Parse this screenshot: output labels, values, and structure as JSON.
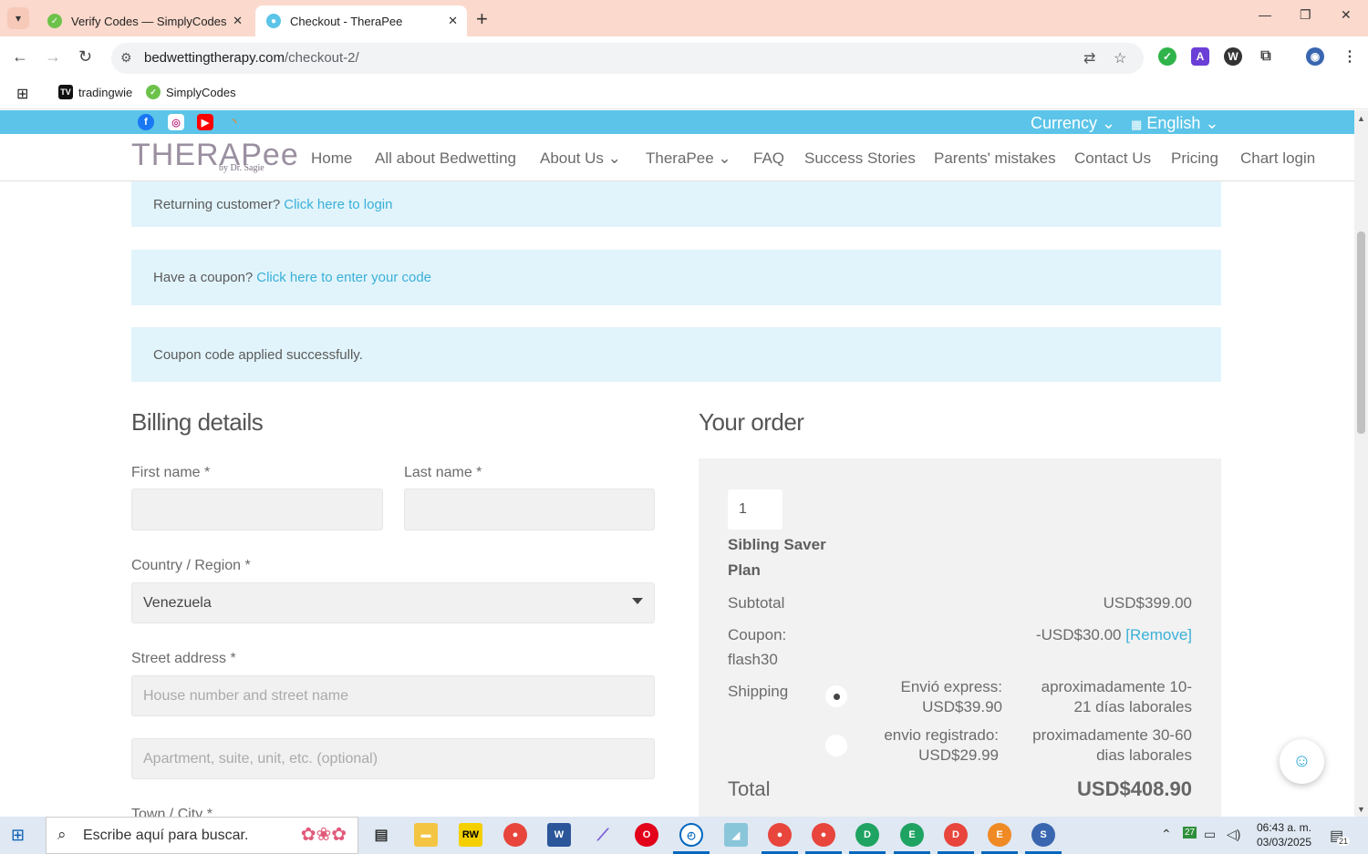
{
  "browser": {
    "tabs": [
      {
        "title": "Verify Codes — SimplyCodes",
        "active": false
      },
      {
        "title": "Checkout - TheraPee",
        "active": true
      }
    ],
    "url_host": "bedwettingtherapy.com",
    "url_path": "/checkout-2/",
    "bookmarks": [
      "tradingwie",
      "SimplyCodes"
    ]
  },
  "site": {
    "strip": {
      "currency": "Currency",
      "language": "English"
    },
    "logo": {
      "main": "THERAPee",
      "sub": "by Dr. Sagie"
    },
    "menu": [
      "Home",
      "All about Bedwetting",
      "About Us",
      "TheraPee",
      "FAQ",
      "Success Stories",
      "Parents' mistakes",
      "Contact Us",
      "Pricing",
      "Chart login"
    ]
  },
  "notices": {
    "returning_text": "Returning customer?",
    "returning_link": "Click here to login",
    "coupon_text": "Have a coupon?",
    "coupon_link": "Click here to enter your code",
    "coupon_applied": "Coupon code applied successfully."
  },
  "billing": {
    "title": "Billing details",
    "first_name_label": "First name *",
    "last_name_label": "Last name *",
    "country_label": "Country / Region *",
    "country_value": "Venezuela",
    "street_label": "Street address *",
    "street_placeholder": "House number and street name",
    "apt_placeholder": "Apartment, suite, unit, etc. (optional)",
    "city_label": "Town / City *"
  },
  "order": {
    "title": "Your order",
    "quantity": "1",
    "product": "Sibling Saver Plan",
    "subtotal_label": "Subtotal",
    "subtotal_value": "USD$399.00",
    "coupon_label": "Coupon: flash30",
    "coupon_value": "-USD$30.00",
    "coupon_remove": "[Remove]",
    "shipping_label": "Shipping",
    "shipping_options": [
      {
        "name": "Envió express:",
        "price": "USD$39.90",
        "desc": "aproximadamente 10-21 días laborales",
        "selected": true
      },
      {
        "name": "envio registrado:",
        "price": "USD$29.99",
        "desc": "proximadamente 30-60 dias laborales",
        "selected": false
      }
    ],
    "total_label": "Total",
    "total_value": "USD$408.90"
  },
  "taskbar": {
    "search_placeholder": "Escribe aquí para buscar.",
    "time": "06:43 a. m.",
    "date": "03/03/2025",
    "temp": "27",
    "notif_count": "21"
  }
}
